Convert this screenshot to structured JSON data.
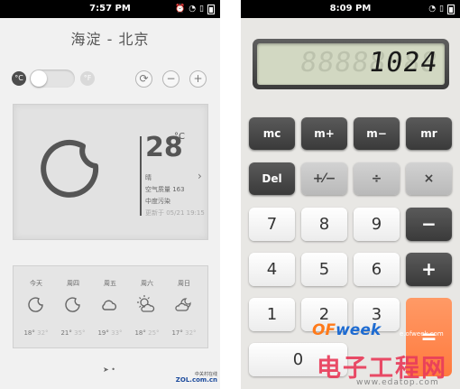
{
  "weather": {
    "status_time": "7:57 PM",
    "city": "海淀 - 北京",
    "unit_c": "°C",
    "unit_f": "°F",
    "refresh_icon": "⟳",
    "minus_icon": "−",
    "plus_icon": "+",
    "temperature": "28",
    "temp_unit": "°C",
    "condition": "晴",
    "air_quality": "空气质量 163",
    "pollution": "中度污染",
    "updated": "更新于 05/21 19:15",
    "forecast": [
      {
        "day": "今天",
        "icon": "moon-icon",
        "low": "18°",
        "high": "32°"
      },
      {
        "day": "周四",
        "icon": "moon-icon",
        "low": "21°",
        "high": "35°"
      },
      {
        "day": "周五",
        "icon": "cloud-icon",
        "low": "19°",
        "high": "33°"
      },
      {
        "day": "周六",
        "icon": "sun-cloud-icon",
        "low": "18°",
        "high": "25°"
      },
      {
        "day": "周日",
        "icon": "cloud-moon-icon",
        "low": "17°",
        "high": "32°"
      }
    ],
    "logo_top": "中关村在线",
    "logo_bottom": "ZOL.com.cn"
  },
  "calculator": {
    "status_time": "8:09 PM",
    "ghost_digits": "88888888",
    "display_value": "1024",
    "keys": {
      "mc": "mc",
      "mplus": "m+",
      "mminus": "m−",
      "mr": "mr",
      "del": "Del",
      "sign": "+⁄−",
      "divide": "÷",
      "multiply": "×",
      "d7": "7",
      "d8": "8",
      "d9": "9",
      "minus": "−",
      "d4": "4",
      "d5": "5",
      "d6": "6",
      "plus": "+",
      "d1": "1",
      "d2": "2",
      "d3": "3",
      "d0": "0",
      "equals": "="
    },
    "watermark_brand_a": "OF",
    "watermark_brand_b": "week",
    "watermark_url1": "e.ofweek.com",
    "watermark_cn": "电子工程网",
    "watermark_url2": "www.edatop.com"
  },
  "colors": {
    "orange_key": "#ff8a50",
    "dark_key": "#4a4a4a",
    "lcd_bg": "#d2d8c2",
    "statusbar": "#000000"
  }
}
